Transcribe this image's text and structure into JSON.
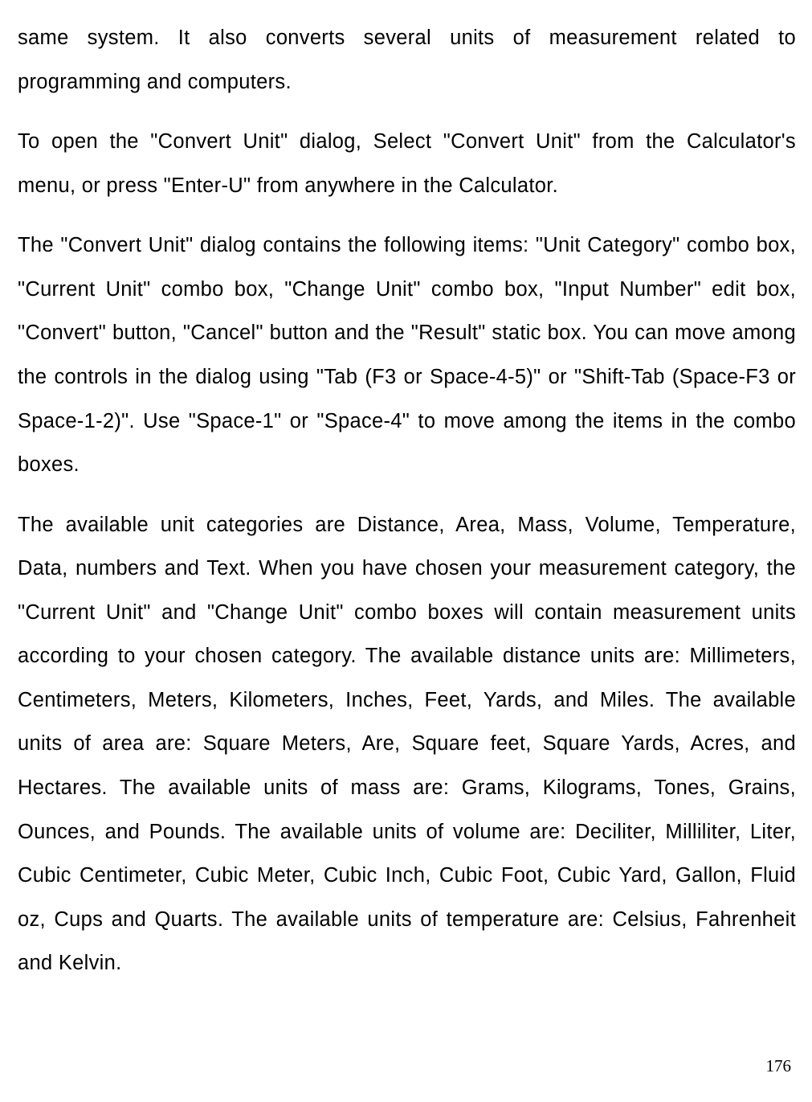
{
  "paragraphs": {
    "p1": "same system. It also converts several units of measurement related to programming and computers.",
    "p2": "To open the \"Convert Unit\" dialog, Select \"Convert Unit\" from the Calculator's menu, or press \"Enter-U\" from anywhere in the Calculator.",
    "p3": "The \"Convert Unit\" dialog contains the following items: \"Unit Category\" combo box, \"Current Unit\" combo box, \"Change Unit\" combo box, \"Input Number\" edit box, \"Convert\" button, \"Cancel\" button and the \"Result\" static box. You can move among the controls in the dialog using \"Tab (F3 or Space-4-5)\" or \"Shift-Tab (Space-F3 or Space-1-2)\". Use \"Space-1\" or \"Space-4\" to move among the items in the combo boxes.",
    "p4": "The available unit categories are Distance, Area, Mass, Volume, Temperature, Data, numbers and Text. When you have chosen your measurement category, the \"Current Unit\" and \"Change Unit\" combo boxes will contain measurement units according to your chosen category. The available distance units are: Millimeters, Centimeters, Meters, Kilometers, Inches, Feet, Yards, and Miles. The available units of area are: Square Meters, Are, Square feet, Square Yards, Acres, and Hectares. The available units of mass are: Grams, Kilograms, Tones, Grains, Ounces, and Pounds. The available units of volume are: Deciliter, Milliliter, Liter, Cubic Centimeter, Cubic Meter, Cubic Inch, Cubic Foot, Cubic Yard, Gallon, Fluid oz, Cups and Quarts. The available units of temperature are: Celsius, Fahrenheit and Kelvin."
  },
  "pageNumber": "176"
}
